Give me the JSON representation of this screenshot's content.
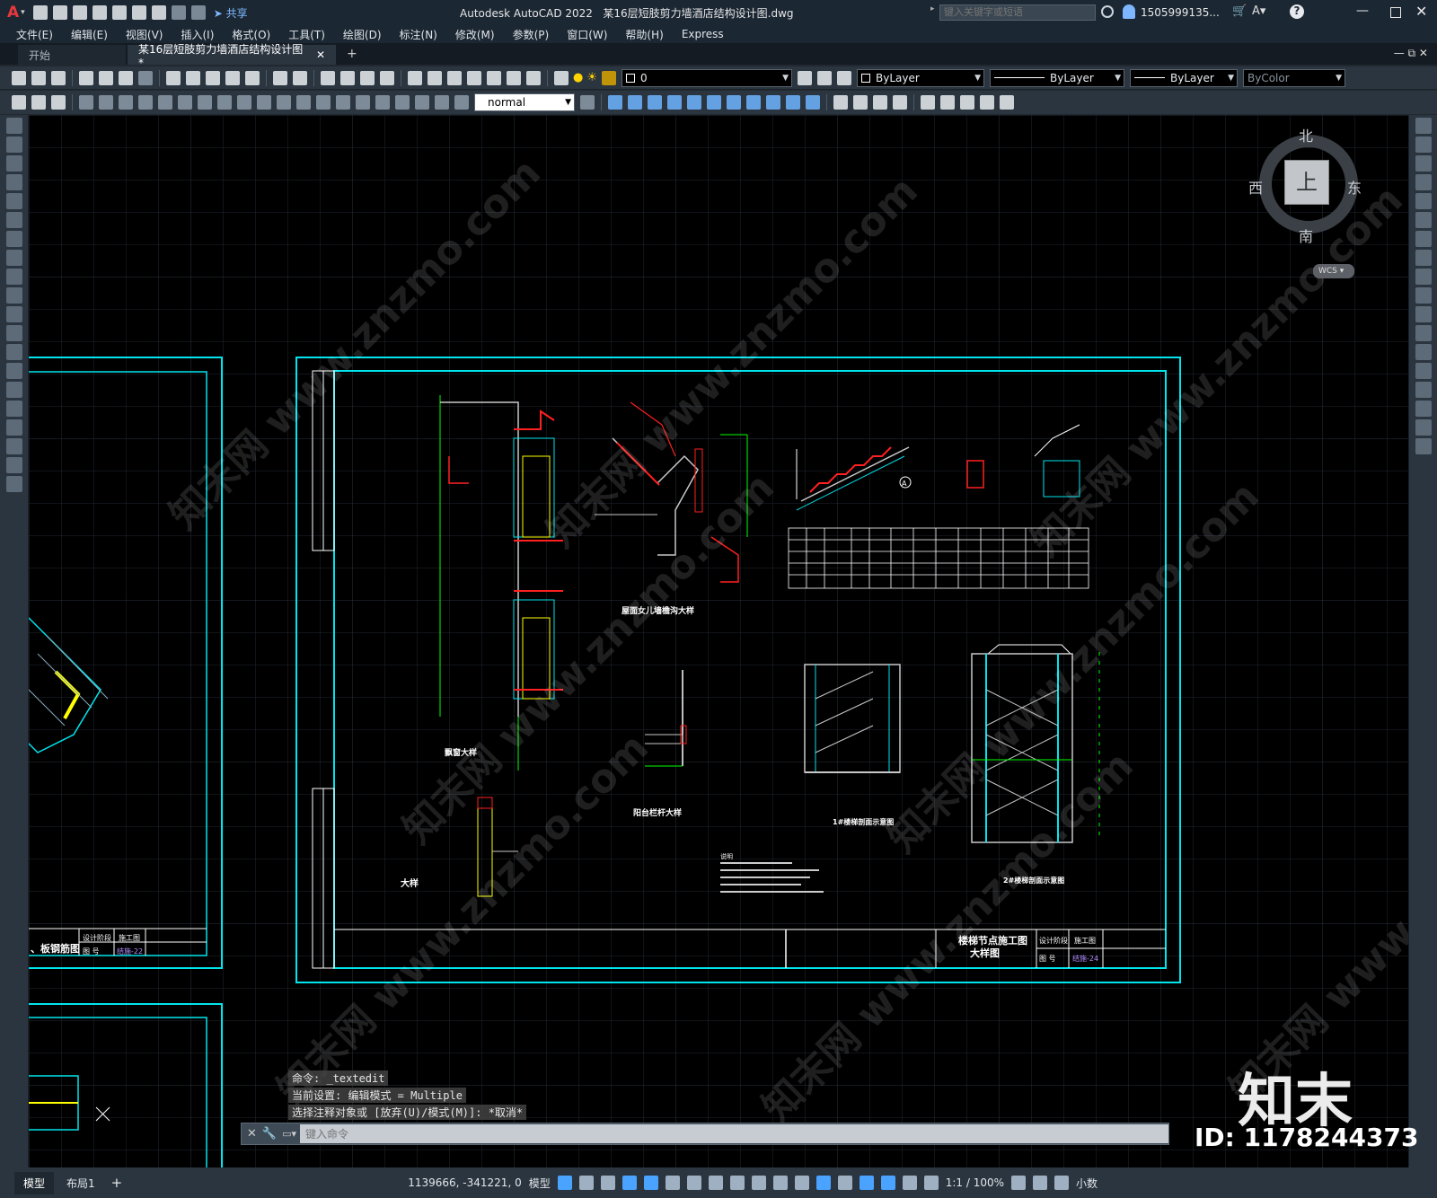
{
  "window": {
    "app_title": "Autodesk AutoCAD 2022",
    "file_title": "某16层短肢剪力墙酒店结构设计图.dwg",
    "search_placeholder": "键入关键字或短语",
    "user": "1505999135...",
    "share_label": "共享"
  },
  "menu": [
    "文件(E)",
    "编辑(E)",
    "视图(V)",
    "插入(I)",
    "格式(O)",
    "工具(T)",
    "绘图(D)",
    "标注(N)",
    "修改(M)",
    "参数(P)",
    "窗口(W)",
    "帮助(H)",
    "Express"
  ],
  "tabs": [
    {
      "label": "开始"
    },
    {
      "label": "某16层短肢剪力墙酒店结构设计图*"
    }
  ],
  "toolbar": {
    "layer_value": "0",
    "color_value": "ByLayer",
    "linetype_value": "ByLayer",
    "lineweight_value": "ByLayer",
    "plotstyle_value": "ByColor",
    "textstyle_value": "normal"
  },
  "viewcube": {
    "north": "北",
    "south": "南",
    "east": "东",
    "west": "西",
    "top": "上",
    "wcs": "WCS"
  },
  "drawing": {
    "sheet_title_1": "楼梯节点施工图",
    "sheet_title_2": "大样图",
    "stage_label": "设计阶段",
    "stage_value": "施工图",
    "sheet_no_label": "图 号",
    "sheet_no_value": "结施-24",
    "left_sheet_title": "、板钢筋图",
    "left_sheet_no": "结施-22",
    "left_stage_label": "设计阶段",
    "left_stage_value": "施工图",
    "left_no_label": "图 号",
    "label_detail": "飘窗大样",
    "label_parapet": "屋面女儿墙檐沟大样",
    "label_balcony": "阳台栏杆大样",
    "label_big": "大样",
    "label_stair1": "1#楼梯剖面示意图",
    "label_stair2": "2#楼梯剖面示意图",
    "label_a": "A",
    "label_notes": "说明"
  },
  "command": {
    "history": [
      "命令: _textedit",
      "当前设置: 编辑模式 = Multiple",
      "选择注释对象或 [放弃(U)/模式(M)]: *取消*"
    ],
    "placeholder": "键入命令"
  },
  "status": {
    "model_tab": "模型",
    "layout_tab": "布局1",
    "coords": "1139666, -341221, 0",
    "mode": "模型",
    "scale": "1:1 / 100%",
    "units": "小数"
  },
  "branding": {
    "logo": "知末",
    "id": "ID: 1178244373",
    "watermark": "知末网 www.znzmo.com"
  },
  "colors": {
    "accent": "#00e5ee",
    "canvas": "#000000",
    "ui": "#2b3540"
  }
}
